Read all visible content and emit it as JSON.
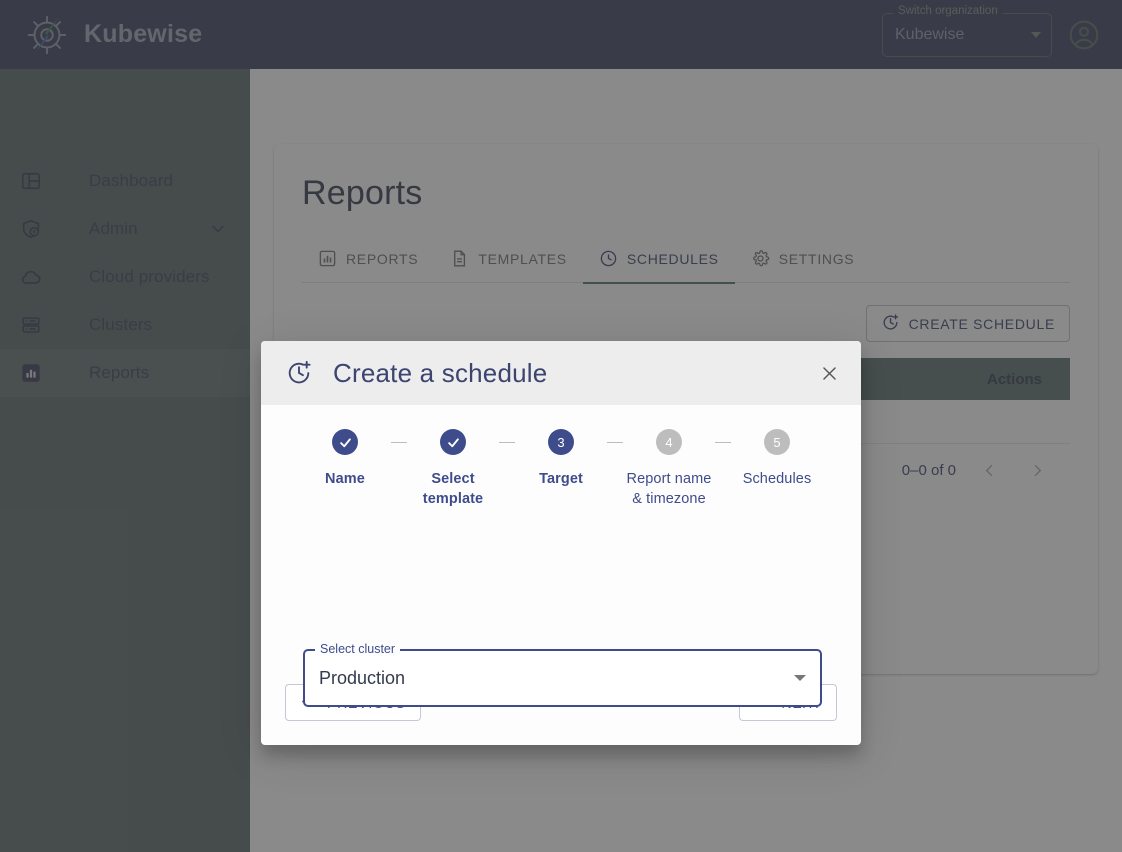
{
  "topbar": {
    "brand_name": "Kubewise",
    "brand_logo_icon": "compass-helm-logo",
    "org_switcher": {
      "label": "Switch organization",
      "value": "Kubewise",
      "caret_icon": "chevron-down-icon"
    },
    "account_icon": "account-circle-icon"
  },
  "sidebar": {
    "items": [
      {
        "label": "Dashboard",
        "icon": "dashboard-icon",
        "active": false,
        "expandable": false
      },
      {
        "label": "Admin",
        "icon": "shield-user-icon",
        "active": false,
        "expandable": true
      },
      {
        "label": "Cloud providers",
        "icon": "cloud-icon",
        "active": false,
        "expandable": false
      },
      {
        "label": "Clusters",
        "icon": "server-rack-icon",
        "active": false,
        "expandable": false
      },
      {
        "label": "Reports",
        "icon": "bar-chart-icon",
        "active": true,
        "expandable": false
      }
    ]
  },
  "page": {
    "title": "Reports",
    "tabs": [
      {
        "label": "REPORTS",
        "icon": "bar-chart-icon",
        "active": false
      },
      {
        "label": "TEMPLATES",
        "icon": "document-icon",
        "active": false
      },
      {
        "label": "SCHEDULES",
        "icon": "clock-icon",
        "active": true
      },
      {
        "label": "SETTINGS",
        "icon": "gear-icon",
        "active": false
      }
    ],
    "create_button": {
      "label": "CREATE SCHEDULE",
      "icon": "clock-plus-icon"
    },
    "table": {
      "headers": [
        "Actions"
      ],
      "rows": [],
      "pagination": {
        "range_label": "0–0 of 0",
        "prev_icon": "chevron-left-icon",
        "next_icon": "chevron-right-icon"
      }
    }
  },
  "modal": {
    "icon": "clock-plus-icon",
    "title": "Create a schedule",
    "close_icon": "close-icon",
    "steps": [
      {
        "number": "1",
        "label": "Name",
        "state": "done",
        "check_icon": "check-icon"
      },
      {
        "number": "2",
        "label": "Select\ntemplate",
        "state": "done",
        "check_icon": "check-icon"
      },
      {
        "number": "3",
        "label": "Target",
        "state": "current"
      },
      {
        "number": "4",
        "label": "Report name\n& timezone",
        "state": "todo"
      },
      {
        "number": "5",
        "label": "Schedules",
        "state": "todo"
      }
    ],
    "cluster_field": {
      "label": "Select cluster",
      "value": "Production",
      "caret_icon": "dropdown-arrow-icon"
    },
    "previous_button": {
      "label": "PREVIOUS",
      "icon": "arrow-left-icon"
    },
    "next_button": {
      "label": "NEXT",
      "icon": "arrow-right-icon"
    }
  },
  "colors": {
    "topbar_bg": "#2b3253",
    "sidebar_bg": "#4e5e5c",
    "accent_navy": "#3f4c8c",
    "accent_green": "#456b5c",
    "table_header_bg": "#4e6560",
    "step_inactive": "#bdbdbd"
  }
}
